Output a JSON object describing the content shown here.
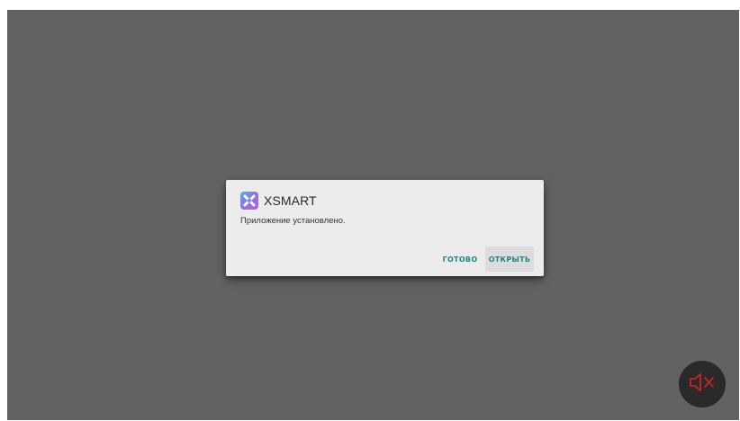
{
  "dialog": {
    "app_name": "XSMART",
    "message": "Приложение установлено.",
    "done_label": "ГОТОВО",
    "open_label": "ОТКРЫТЬ"
  },
  "colors": {
    "backdrop": "#626262",
    "dialog_bg": "#ececec",
    "button_text": "#1d8a80",
    "mute_icon": "#e02020",
    "mute_fab_bg": "#2a2a2a"
  },
  "icons": {
    "app": "xsmart-app-icon",
    "mute": "speaker-muted-icon"
  }
}
